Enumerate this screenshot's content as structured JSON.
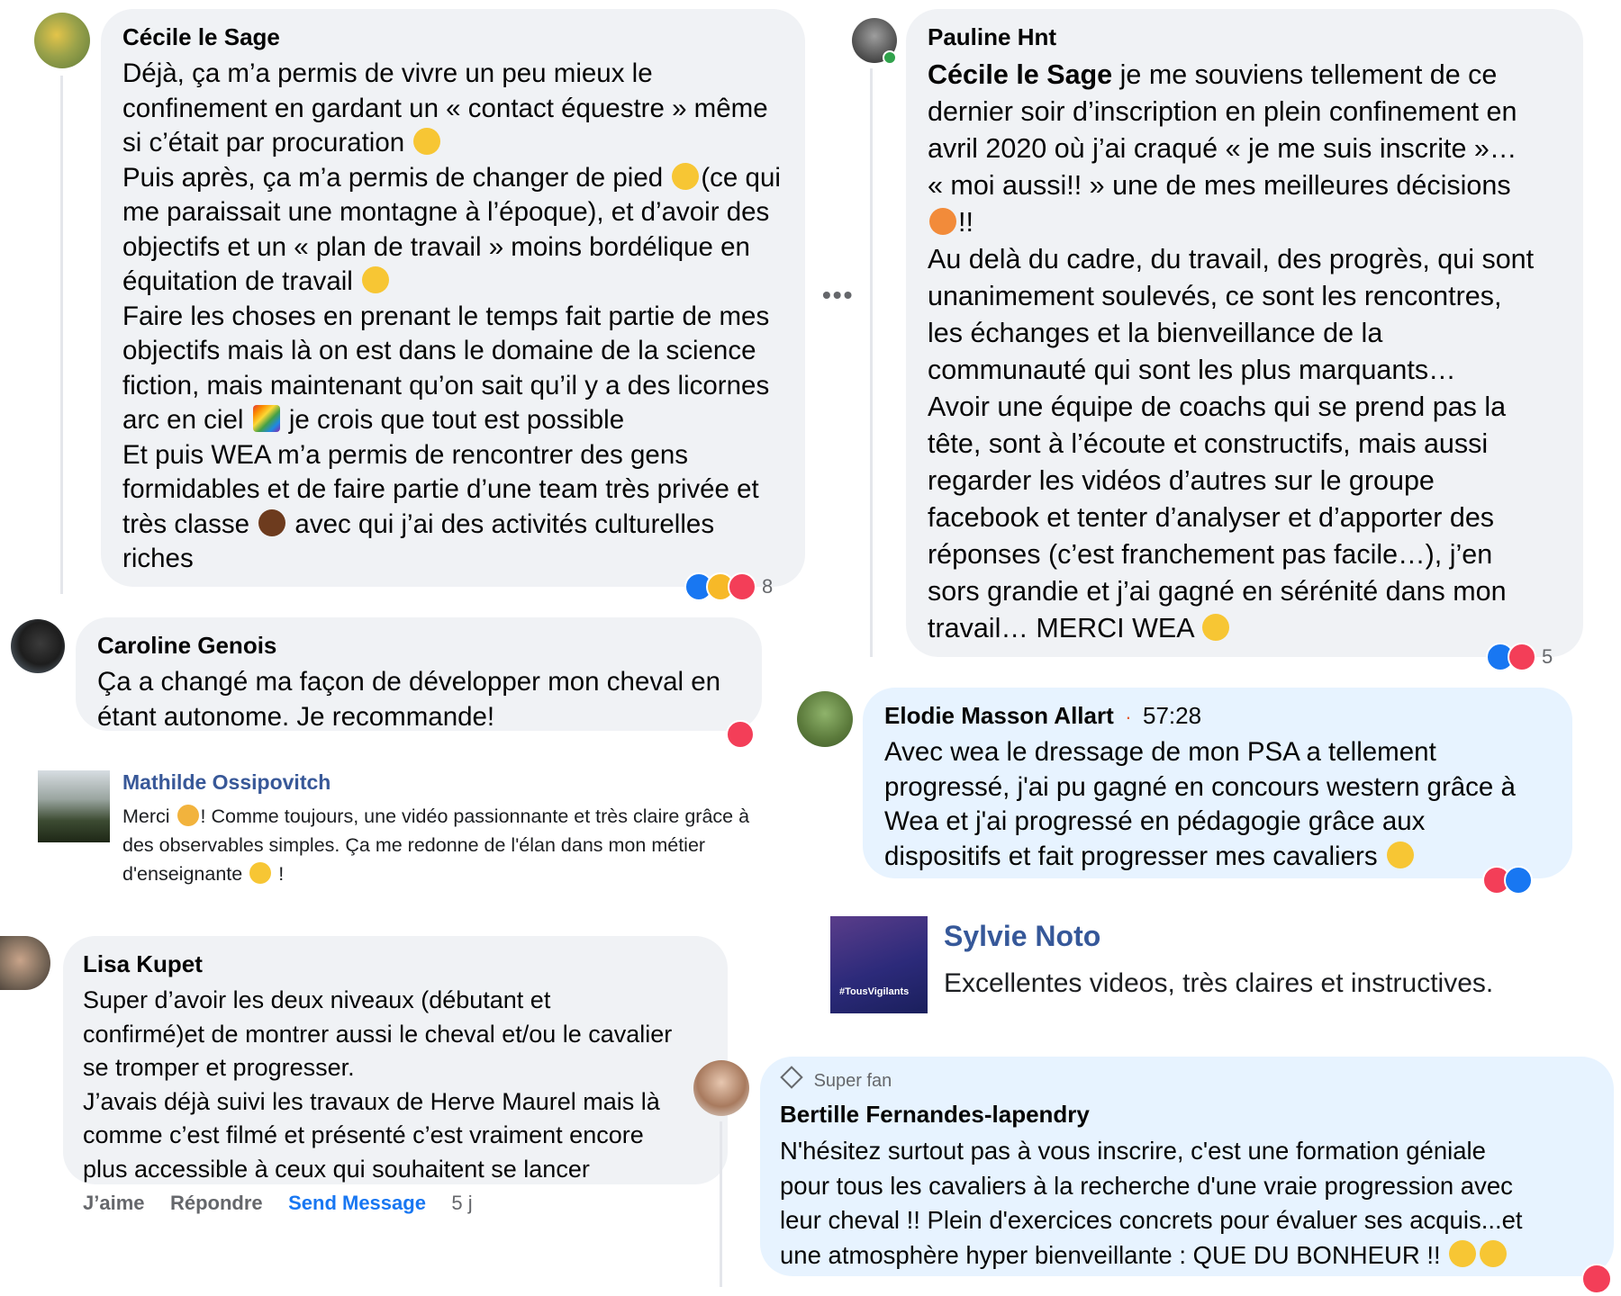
{
  "comments": [
    {
      "name": "Cécile le Sage",
      "lines": [
        "Déjà, ça m’a permis de vivre un peu mieux le",
        "confinement en gardant un « contact équestre » même",
        "si c’était par procuration",
        "Puis après, ça m’a permis de changer de pied",
        "(ce qui",
        "me paraissait une montagne à l’époque), et d’avoir des",
        "objectifs et un « plan de travail » moins bordélique en",
        "équitation de travail",
        "Faire les choses en prenant le temps fait partie de mes",
        "objectifs mais là on est dans le domaine de la science",
        "fiction, mais maintenant qu’on sait qu’il y a des licornes",
        "arc en ciel",
        "je crois que tout est possible",
        "Et puis WEA m’a permis de rencontrer des gens",
        "formidables et de faire partie d’une team très privée et",
        "très classe",
        "avec qui j’ai des activités culturelles",
        "riches"
      ],
      "reaction_count": "8"
    },
    {
      "name": "Pauline Hnt",
      "mention": "Cécile le Sage",
      "lines": [
        " je me souviens tellement de ce",
        "dernier soir d’inscription en plein confinement en",
        "avril 2020 où j’ai craqué « je me suis inscrite »…",
        "« moi aussi!! » une de mes meilleures décisions",
        "!!",
        "Au delà du cadre, du travail, des progrès, qui sont",
        "unanimement soulevés, ce sont les rencontres,",
        "les échanges et la bienveillance de la",
        "communauté qui sont les plus marquants…",
        "Avoir une équipe de coachs qui se prend pas la",
        "tête, sont à l’écoute et constructifs, mais aussi",
        "regarder les vidéos d’autres sur le groupe",
        "facebook et tenter d’analyser et d’apporter des",
        "réponses (c’est franchement pas facile…), j’en",
        "sors grandie et j’ai gagné en sérénité dans mon",
        "travail… MERCI WEA"
      ],
      "reaction_count": "5"
    },
    {
      "name": "Caroline Genois",
      "lines": [
        "Ça a changé ma façon de développer mon cheval en",
        "étant autonome. Je recommande!"
      ]
    },
    {
      "name": "Elodie Masson Allart",
      "time": "57:28",
      "separator": "·",
      "lines": [
        "Avec wea le dressage de mon PSA a tellement",
        "progressé, j'ai pu gagné en concours western grâce à",
        "Wea et j'ai progressé en pédagogie grâce aux",
        "dispositifs et fait progresser mes cavaliers"
      ]
    },
    {
      "name": "Mathilde Ossipovitch",
      "lines": [
        "Merci",
        "! Comme toujours, une vidéo passionnante et très claire grâce à",
        "des observables simples. Ça me redonne de l'élan dans mon métier",
        "d'enseignante",
        "!"
      ]
    },
    {
      "name": "Sylvie Noto",
      "text": "Excellentes videos, très claires et instructives.",
      "avatar_text": "#TousVigilants"
    },
    {
      "name": "Lisa Kupet",
      "lines": [
        "Super d’avoir les deux niveaux (débutant et",
        "confirmé)et de montrer aussi le cheval et/ou le cavalier",
        "se tromper et progresser.",
        "J’avais déjà suivi les travaux de Herve Maurel mais là",
        "comme c’est filmé et présenté c’est vraiment encore",
        "plus accessible à ceux qui souhaitent se lancer"
      ],
      "actions": {
        "like": "J’aime",
        "reply": "Répondre",
        "message": "Send Message",
        "time": "5 j"
      }
    },
    {
      "badge": "Super fan",
      "name": "Bertille Fernandes-lapendry",
      "lines": [
        "N'hésitez surtout pas à vous inscrire, c'est une formation géniale",
        "pour tous les cavaliers à la recherche d'une vraie progression avec",
        "leur cheval !! Plein d'exercices concrets pour évaluer ses acquis...et",
        "une atmosphère hyper bienveillante : QUE DU BONHEUR !!"
      ]
    }
  ],
  "icons": {
    "more": "more-options-icon",
    "diamond": "super-fan-diamond-icon"
  },
  "colors": {
    "bubble_gray": "#f0f2f5",
    "bubble_blue": "#e7f3ff",
    "link_blue": "#385898",
    "fb_blue": "#1877f2",
    "love_red": "#f33e58"
  }
}
